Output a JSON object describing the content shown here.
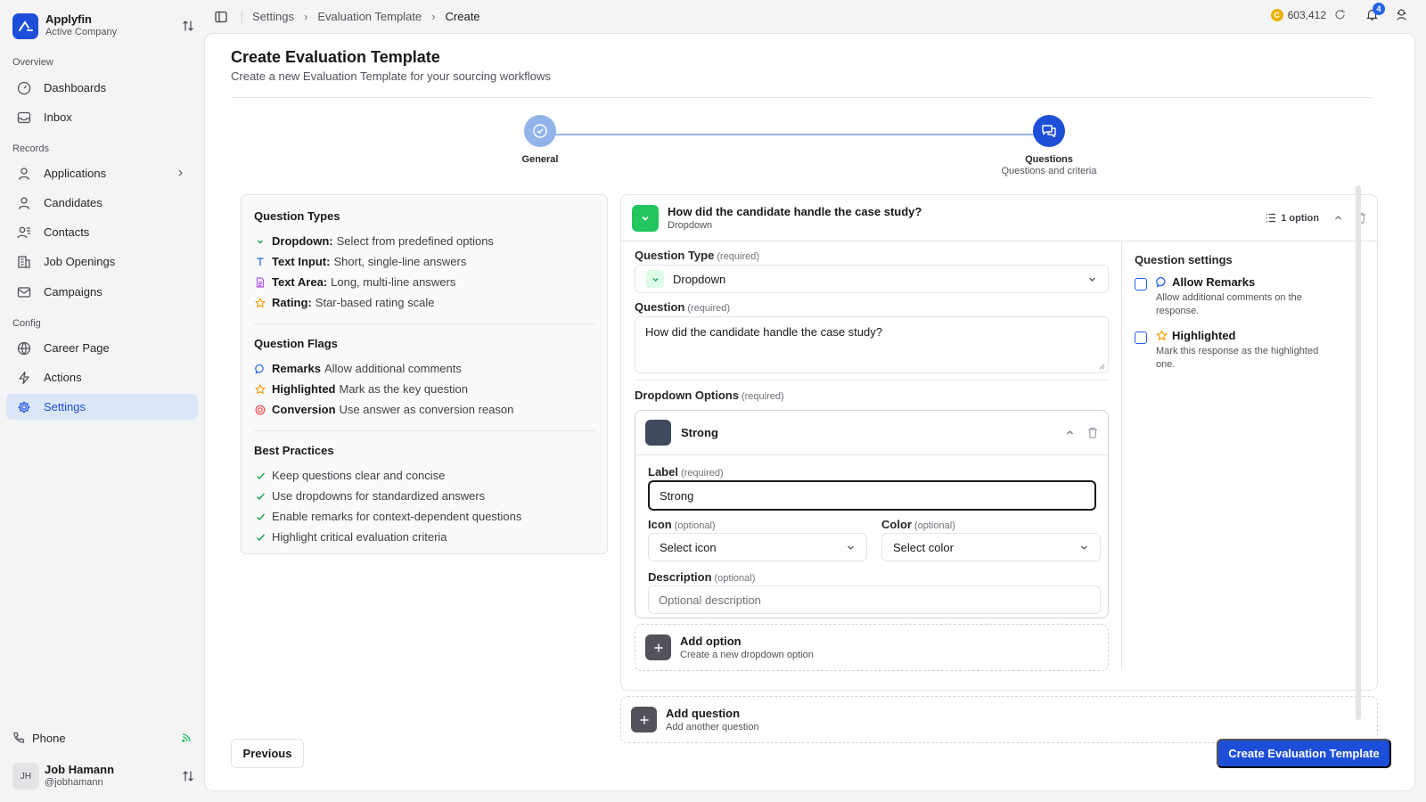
{
  "brand": {
    "name": "Applyfin",
    "subtitle": "Active Company"
  },
  "sidebar": {
    "sections": [
      "Overview",
      "Records",
      "Config"
    ],
    "items": [
      {
        "label": "Dashboards",
        "icon": "gauge-icon"
      },
      {
        "label": "Inbox",
        "icon": "inbox-icon"
      },
      {
        "label": "Applications",
        "icon": "user-icon"
      },
      {
        "label": "Candidates",
        "icon": "user-icon"
      },
      {
        "label": "Contacts",
        "icon": "users-icon"
      },
      {
        "label": "Job Openings",
        "icon": "building-icon"
      },
      {
        "label": "Campaigns",
        "icon": "mail-icon"
      },
      {
        "label": "Career Page",
        "icon": "globe-icon"
      },
      {
        "label": "Actions",
        "icon": "zap-icon"
      },
      {
        "label": "Settings",
        "icon": "gear-icon"
      }
    ],
    "active": "Settings",
    "phone_label": "Phone",
    "user": {
      "initials": "JH",
      "name": "Job Hamann",
      "handle": "@jobhamann"
    }
  },
  "topbar": {
    "breadcrumbs": [
      "Settings",
      "Evaluation Template",
      "Create"
    ],
    "coins": "603,412",
    "coin_symbol": "C",
    "notifications": "4"
  },
  "page": {
    "title": "Create Evaluation Template",
    "subtitle": "Create a new Evaluation Template for your sourcing workflows"
  },
  "stepper": {
    "steps": [
      {
        "title": "General",
        "subtitle": ""
      },
      {
        "title": "Questions",
        "subtitle": "Questions and criteria"
      }
    ]
  },
  "info": {
    "types_title": "Question Types",
    "types": [
      {
        "name": "Dropdown:",
        "desc": "Select from predefined options"
      },
      {
        "name": "Text Input:",
        "desc": "Short, single-line answers"
      },
      {
        "name": "Text Area:",
        "desc": "Long, multi-line answers"
      },
      {
        "name": "Rating:",
        "desc": "Star-based rating scale"
      }
    ],
    "flags_title": "Question Flags",
    "flags": [
      {
        "name": "Remarks",
        "desc": "Allow additional comments"
      },
      {
        "name": "Highlighted",
        "desc": "Mark as the key question"
      },
      {
        "name": "Conversion",
        "desc": "Use answer as conversion reason"
      }
    ],
    "practices_title": "Best Practices",
    "practices": [
      "Keep questions clear and concise",
      "Use dropdowns for standardized answers",
      "Enable remarks for context-dependent questions",
      "Highlight critical evaluation criteria"
    ]
  },
  "question": {
    "title": "How did the candidate handle the case study?",
    "type": "Dropdown",
    "options_count": "1 option",
    "type_label": "Question Type",
    "question_label": "Question",
    "required": "(required)",
    "optional": "(optional)",
    "type_value": "Dropdown",
    "question_value": "How did the candidate handle the case study?",
    "options_label": "Dropdown Options",
    "option": {
      "title": "Strong",
      "label_label": "Label",
      "label_value": "Strong",
      "icon_label": "Icon",
      "icon_value": "Select icon",
      "color_label": "Color",
      "color_value": "Select color",
      "desc_label": "Description",
      "desc_placeholder": "Optional description"
    },
    "add_option": {
      "title": "Add option",
      "subtitle": "Create a new dropdown option"
    },
    "settings": {
      "title": "Question settings",
      "remarks": {
        "title": "Allow Remarks",
        "desc": "Allow additional comments on the response."
      },
      "highlighted": {
        "title": "Highlighted",
        "desc": "Mark this response as the highlighted one."
      }
    }
  },
  "add_question": {
    "title": "Add question",
    "subtitle": "Add another question"
  },
  "buttons": {
    "previous": "Previous",
    "create": "Create Evaluation Template"
  },
  "colors": {
    "accent": "#1d4ed8",
    "success": "#22c55e",
    "active_bg": "#dbe7f9"
  }
}
